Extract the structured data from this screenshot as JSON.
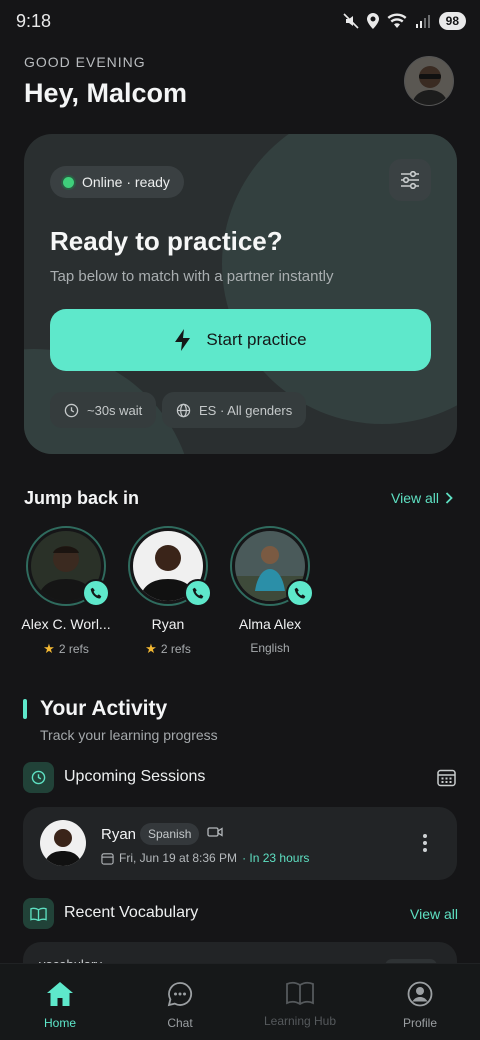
{
  "status_bar": {
    "time": "9:18",
    "battery": "98"
  },
  "header": {
    "greeting": "GOOD EVENING",
    "name": "Hey, Malcom"
  },
  "hero": {
    "status": "Online · ready",
    "title": "Ready to practice?",
    "subtitle": "Tap below to match with a partner instantly",
    "start_label": "Start practice",
    "wait": "~30s wait",
    "filter": "ES · All genders"
  },
  "jump_back": {
    "title": "Jump back in",
    "view_all": "View all",
    "partners": [
      {
        "name": "Alex C. Worl...",
        "meta": "2 refs",
        "starred": true
      },
      {
        "name": "Ryan",
        "meta": "2 refs",
        "starred": true
      },
      {
        "name": "Alma Alex",
        "meta": "English",
        "starred": false
      }
    ]
  },
  "activity": {
    "title": "Your Activity",
    "subtitle": "Track your learning progress",
    "upcoming": {
      "title": "Upcoming Sessions",
      "session": {
        "name": "Ryan",
        "language": "Spanish",
        "date": "Fri, Jun 19 at 8:36 PM",
        "relative": " · In 23 hours"
      }
    },
    "vocab": {
      "title": "Recent Vocabulary",
      "view_all": "View all",
      "peek": "vocabulary"
    }
  },
  "nav": [
    {
      "label": "Home",
      "state": "active"
    },
    {
      "label": "Chat",
      "state": "normal"
    },
    {
      "label": "Learning Hub",
      "state": "disabled"
    },
    {
      "label": "Profile",
      "state": "normal"
    }
  ],
  "colors": {
    "accent": "#5ee8cb",
    "background": "#151517",
    "card": "#222426",
    "online": "#3fd07b",
    "star": "#f3b833"
  }
}
